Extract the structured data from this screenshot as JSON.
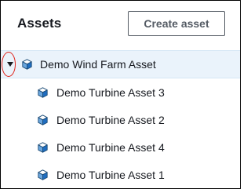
{
  "header": {
    "title": "Assets",
    "create_button_label": "Create asset"
  },
  "tree": {
    "root": {
      "label": "Demo Wind Farm Asset",
      "expanded": true,
      "icon": "cube-icon"
    },
    "children": [
      {
        "label": "Demo Turbine Asset 3",
        "icon": "cube-icon"
      },
      {
        "label": "Demo Turbine Asset 2",
        "icon": "cube-icon"
      },
      {
        "label": "Demo Turbine Asset 4",
        "icon": "cube-icon"
      },
      {
        "label": "Demo Turbine Asset 1",
        "icon": "cube-icon"
      }
    ]
  },
  "colors": {
    "selected_row_bg": "#eaf3fb",
    "text": "#16191f",
    "icon_blue": "#1f6dc0",
    "highlight_ring": "#e0241b"
  }
}
